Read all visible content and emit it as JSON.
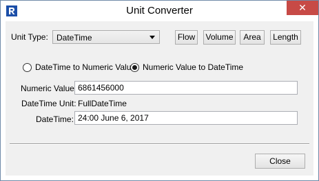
{
  "window": {
    "title": "Unit Converter",
    "close_glyph": "✕"
  },
  "unit_type": {
    "label": "Unit Type:",
    "selected": "DateTime"
  },
  "unit_buttons": {
    "flow": "Flow",
    "volume": "Volume",
    "area": "Area",
    "length": "Length"
  },
  "mode": {
    "option_a": "DateTime to Numeric Value",
    "option_b": "Numeric Value to DateTime",
    "selected": "option_b"
  },
  "fields": {
    "numeric_label": "Numeric Value:",
    "numeric_value": "6861456000",
    "unit_label": "DateTime Unit:",
    "unit_value": "FullDateTime",
    "datetime_label": "DateTime:",
    "datetime_value": "24:00 June 6, 2017"
  },
  "footer": {
    "close_label": "Close"
  },
  "colors": {
    "title_close_bg": "#c74a46",
    "dialog_bg": "#f0f0f0",
    "app_icon_blue": "#1c4fa8"
  },
  "icons": {
    "app": "riverware-r-icon",
    "select_arrow": "chevron-down-icon"
  }
}
